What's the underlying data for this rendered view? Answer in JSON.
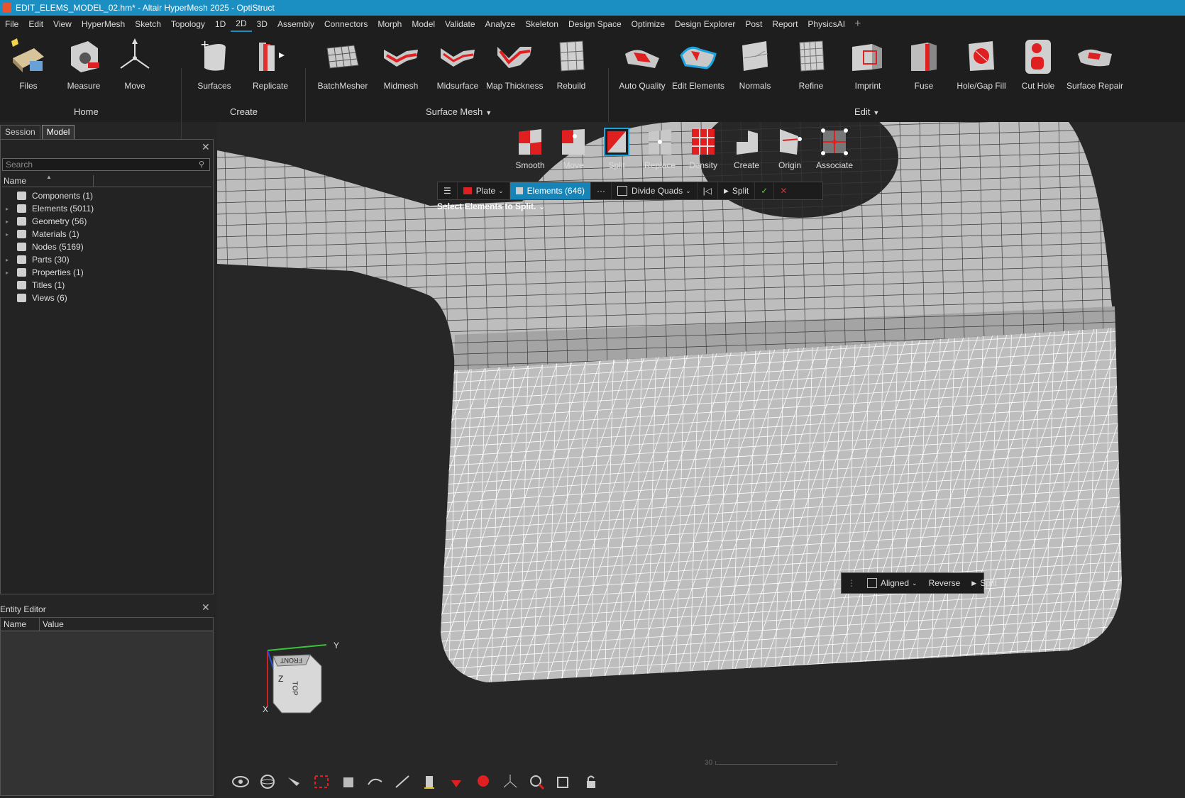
{
  "window": {
    "title": "EDIT_ELEMS_MODEL_02.hm* - Altair HyperMesh 2025 - OptiStruct"
  },
  "menu": [
    "File",
    "Edit",
    "View",
    "HyperMesh",
    "Sketch",
    "Topology",
    "1D",
    "2D",
    "3D",
    "Assembly",
    "Connectors",
    "Morph",
    "Model",
    "Validate",
    "Analyze",
    "Skeleton",
    "Design Space",
    "Optimize",
    "Design Explorer",
    "Post",
    "Report",
    "PhysicsAI"
  ],
  "menu_active": "2D",
  "ribbon": {
    "groups": {
      "home": "Home",
      "create": "Create",
      "surface_mesh": "Surface Mesh",
      "edit": "Edit"
    },
    "tools": {
      "files": "Files",
      "measure": "Measure",
      "move": "Move",
      "surfaces": "Surfaces",
      "replicate": "Replicate",
      "batchmesher": "BatchMesher",
      "midmesh": "Midmesh",
      "midsurface": "Midsurface",
      "map_thickness": "Map Thickness",
      "rebuild": "Rebuild",
      "auto_quality": "Auto Quality",
      "edit_elements": "Edit Elements",
      "normals": "Normals",
      "refine": "Refine",
      "imprint": "Imprint",
      "fuse": "Fuse",
      "hole_gap_fill": "Hole/Gap Fill",
      "cut_hole": "Cut Hole",
      "surface_repair": "Surface Repair"
    }
  },
  "panel": {
    "tabs": [
      "Session",
      "Model"
    ],
    "active_tab": "Model",
    "search_placeholder": "Search",
    "columns": {
      "name": "Name"
    },
    "tree": [
      {
        "label": "Components  (1)",
        "expandable": false
      },
      {
        "label": "Elements  (5011)",
        "expandable": true
      },
      {
        "label": "Geometry  (56)",
        "expandable": true
      },
      {
        "label": "Materials  (1)",
        "expandable": true
      },
      {
        "label": "Nodes  (5169)",
        "expandable": false
      },
      {
        "label": "Parts  (30)",
        "expandable": true
      },
      {
        "label": "Properties  (1)",
        "expandable": true
      },
      {
        "label": "Titles  (1)",
        "expandable": false
      },
      {
        "label": "Views  (6)",
        "expandable": false
      }
    ]
  },
  "entity_editor": {
    "title": "Entity Editor",
    "col_name": "Name",
    "col_value": "Value"
  },
  "subtools": {
    "smooth": "Smooth",
    "move": "Move",
    "split": "Split",
    "replace": "Replace",
    "density": "Density",
    "create": "Create",
    "origin": "Origin",
    "associate": "Associate"
  },
  "context_bar": {
    "plate": "Plate",
    "elements": "Elements (646)",
    "more": "···",
    "mode": "Divide Quads",
    "split": "Split"
  },
  "prompt": "Select Elements to Split.",
  "float_bar": {
    "aligned": "Aligned",
    "reverse": "Reverse",
    "split": "Split"
  },
  "triad": {
    "y": "Y",
    "z": "Z",
    "x": "X",
    "front": "FRONT",
    "top": "TOP"
  },
  "scale_label": "30",
  "colors": {
    "accent": "#1b8fc2",
    "mesh_fill": "#bdbdbd",
    "mesh_line": "#3a3a3a",
    "tri_line": "#ffffff",
    "highlight_red": "#e02020"
  }
}
